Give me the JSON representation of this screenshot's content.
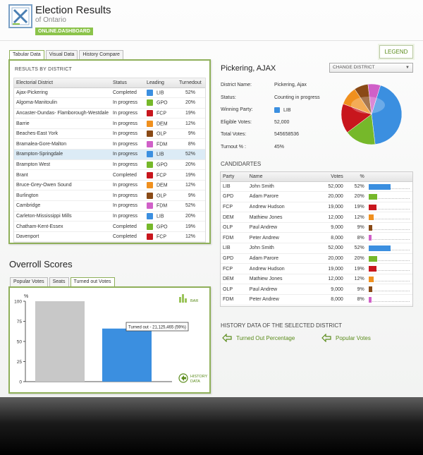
{
  "header": {
    "title": "Election Results",
    "subtitle": "of Ontario",
    "badge": "ONLINE.DASHBOARD",
    "legend_label": "LEGEND"
  },
  "left_tabs": [
    {
      "label": "Tabular Data",
      "active": true
    },
    {
      "label": "Visual Data",
      "active": false
    },
    {
      "label": "History Compare",
      "active": false
    }
  ],
  "results": {
    "caption": "RESULTS BY DISTRICT",
    "columns": [
      "Electorial District",
      "Status",
      "Leading",
      "Turnedout"
    ],
    "rows": [
      {
        "district": "Ajax-Pickering",
        "status": "Completed",
        "party": "LIB",
        "turnout": "52%"
      },
      {
        "district": "Algoma-Manitoulin",
        "status": "In progress",
        "party": "GPO",
        "turnout": "20%"
      },
      {
        "district": "Ancaster-Dundas- Flamborough-Westdale",
        "status": "In progress",
        "party": "FCP",
        "turnout": "19%"
      },
      {
        "district": "Barrie",
        "status": "In progress",
        "party": "DEM",
        "turnout": "12%"
      },
      {
        "district": "Beaches-East York",
        "status": "In progress",
        "party": "OLP",
        "turnout": "9%"
      },
      {
        "district": "Bramalea-Gore-Malton",
        "status": "In progress",
        "party": "FDM",
        "turnout": "8%"
      },
      {
        "district": "Brampton-Springdale",
        "status": "In progress",
        "party": "LIB",
        "turnout": "52%"
      },
      {
        "district": "Brampton West",
        "status": "In progress",
        "party": "GPO",
        "turnout": "20%"
      },
      {
        "district": "Brant",
        "status": "Completed",
        "party": "FCP",
        "turnout": "19%"
      },
      {
        "district": "Bruce-Grey-Owen Sound",
        "status": "In progress",
        "party": "DEM",
        "turnout": "12%"
      },
      {
        "district": "Burlington",
        "status": "In progress",
        "party": "OLP",
        "turnout": "9%"
      },
      {
        "district": "Cambridge",
        "status": "In progress",
        "party": "FDM",
        "turnout": "52%"
      },
      {
        "district": "Carleton-Mississippi Mills",
        "status": "In progress",
        "party": "LIB",
        "turnout": "20%"
      },
      {
        "district": "Chatham-Kent-Essex",
        "status": "Completed",
        "party": "GPO",
        "turnout": "19%"
      },
      {
        "district": "Davenport",
        "status": "Completed",
        "party": "FCP",
        "turnout": "12%"
      }
    ],
    "selected_index": 6
  },
  "party_colors": {
    "LIB": "#3b8fe0",
    "GPO": "#76b82a",
    "FCP": "#c8161d",
    "DEM": "#f0901e",
    "OLP": "#8a4a16",
    "FDM": "#d060c8"
  },
  "district": {
    "title": "Pickering, AJAX",
    "change_label": "CHANGE DISTRICT",
    "fields": [
      {
        "label": "District Name:",
        "value": "Pickering, Ajax"
      },
      {
        "label": "Status:",
        "value": "Counting in progress"
      },
      {
        "label": "Winning Party:",
        "value": "LIB"
      },
      {
        "label": "Eligible Votes:",
        "value": "52,000"
      },
      {
        "label": "Total Votes:",
        "value": "545658536"
      },
      {
        "label": "Turnout % :",
        "value": "45%"
      }
    ]
  },
  "candidates": {
    "caption": "CANDIDARTES",
    "columns": [
      "Party",
      "Name",
      "Votes",
      "%"
    ],
    "rows": [
      {
        "party": "LIB",
        "name": "John Smith",
        "votes": "52,000",
        "pct": "52%",
        "share": 52
      },
      {
        "party": "GPD",
        "name": "Adam Parore",
        "votes": "20,000",
        "pct": "20%",
        "share": 20
      },
      {
        "party": "FCP",
        "name": "Andrew Hudson",
        "votes": "19,000",
        "pct": "19%",
        "share": 19
      },
      {
        "party": "DEM",
        "name": "Mathiew Jones",
        "votes": "12,000",
        "pct": "12%",
        "share": 12
      },
      {
        "party": "OLP",
        "name": "Paul Andrew",
        "votes": "9,000",
        "pct": "9%",
        "share": 9
      },
      {
        "party": "FDM",
        "name": "Peter Andrew",
        "votes": "8,000",
        "pct": "8%",
        "share": 8
      },
      {
        "party": "LIB",
        "name": "John Smith",
        "votes": "52,000",
        "pct": "52%",
        "share": 52
      },
      {
        "party": "GPD",
        "name": "Adam Parore",
        "votes": "20,000",
        "pct": "20%",
        "share": 20
      },
      {
        "party": "FCP",
        "name": "Andrew Hudson",
        "votes": "19,000",
        "pct": "19%",
        "share": 19
      },
      {
        "party": "DEM",
        "name": "Mathiew Jones",
        "votes": "12,000",
        "pct": "12%",
        "share": 12
      },
      {
        "party": "OLP",
        "name": "Paul Andrew",
        "votes": "9,000",
        "pct": "9%",
        "share": 9
      },
      {
        "party": "FDM",
        "name": "Peter Andrew",
        "votes": "8,000",
        "pct": "8%",
        "share": 8
      }
    ]
  },
  "history": {
    "caption": "HISTORY DATA OF THE SELECTED DISTRICT",
    "links": [
      "Turned Out Percentage",
      "Popular Votes"
    ]
  },
  "scores": {
    "title": "Overroll Scores",
    "tabs": [
      {
        "label": "Popular Votes",
        "active": false
      },
      {
        "label": "Seats",
        "active": false
      },
      {
        "label": "Turned out Votes",
        "active": true
      }
    ],
    "bar_toggle": "BAR",
    "history_button": [
      "HISTORY",
      "DATA"
    ]
  },
  "chart_data": [
    {
      "type": "pie",
      "values": [
        52,
        20,
        19,
        12,
        9,
        8
      ],
      "colors": [
        "#3b8fe0",
        "#76b82a",
        "#c8161d",
        "#f0901e",
        "#8a4a16",
        "#d060c8"
      ]
    },
    {
      "type": "bar",
      "ylabel": "%",
      "ylim": [
        0,
        100
      ],
      "yticks": [
        0,
        25,
        50,
        75,
        100
      ],
      "categories": [
        "",
        ""
      ],
      "values": [
        100,
        66
      ],
      "colors": [
        "#c8c8c8",
        "#3b8fe0"
      ],
      "annotation": "Turned out - 21,125,465 (59%)"
    }
  ]
}
